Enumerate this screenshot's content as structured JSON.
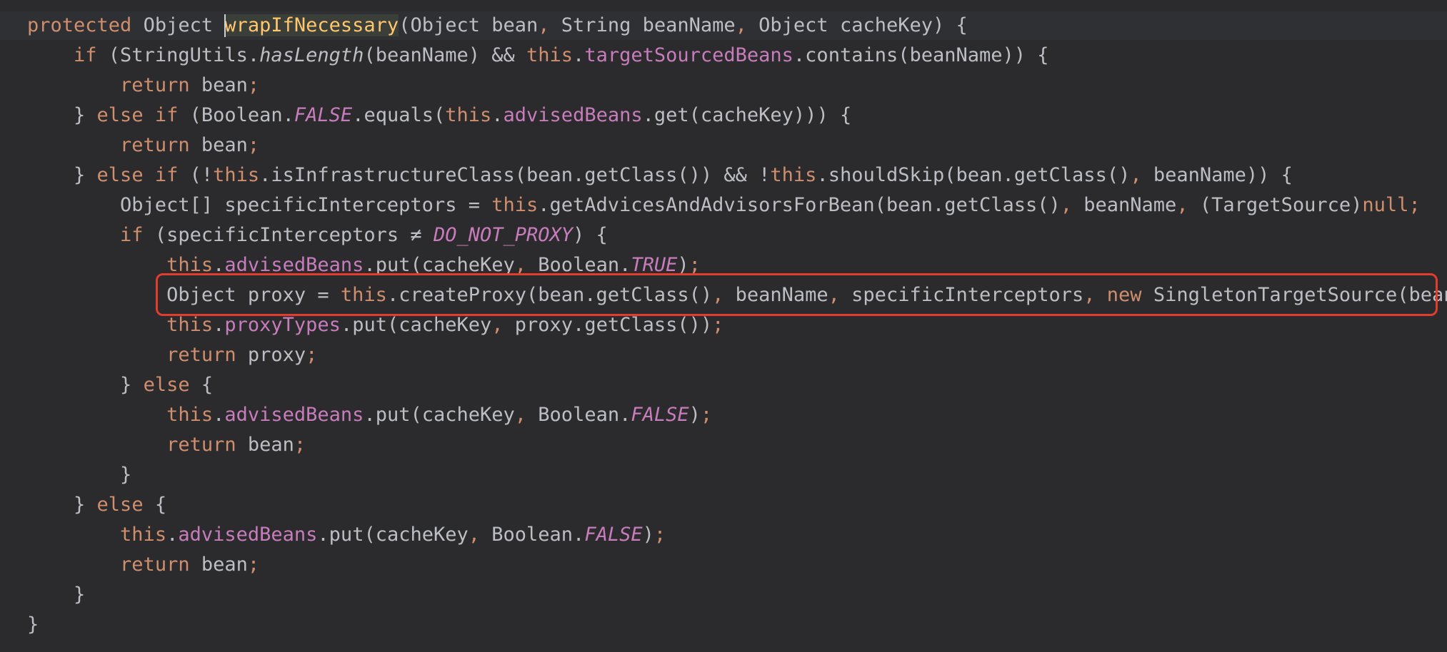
{
  "editor": {
    "language": "java",
    "theme_colors": {
      "background": "#2b2b2d",
      "keyword": "#cf8e6d",
      "field": "#c77dbb",
      "method_declaration": "#ffc66d",
      "text": "#bcbec4",
      "highlight_box": "#e23c2f"
    },
    "highlighted_line_index": 9,
    "lines": [
      [
        {
          "t": "protected",
          "c": "kw"
        },
        {
          "t": " Object "
        },
        {
          "t": "wrapIfNecessary",
          "c": "fn ident-hl"
        },
        {
          "t": "(Object bean"
        },
        {
          "t": ", ",
          "c": "kw"
        },
        {
          "t": "String beanName"
        },
        {
          "t": ", ",
          "c": "kw"
        },
        {
          "t": "Object cacheKey) {"
        }
      ],
      [
        {
          "t": "    "
        },
        {
          "t": "if",
          "c": "kw"
        },
        {
          "t": " (StringUtils."
        },
        {
          "t": "hasLength",
          "c": "ital"
        },
        {
          "t": "(beanName) && "
        },
        {
          "t": "this",
          "c": "kw"
        },
        {
          "t": "."
        },
        {
          "t": "targetSourcedBeans",
          "c": "fld"
        },
        {
          "t": ".contains(beanName)) {"
        }
      ],
      [
        {
          "t": "        "
        },
        {
          "t": "return",
          "c": "kw"
        },
        {
          "t": " bean"
        },
        {
          "t": ";",
          "c": "kw"
        }
      ],
      [
        {
          "t": "    } "
        },
        {
          "t": "else if",
          "c": "kw"
        },
        {
          "t": " (Boolean."
        },
        {
          "t": "FALSE",
          "c": "sfld"
        },
        {
          "t": ".equals("
        },
        {
          "t": "this",
          "c": "kw"
        },
        {
          "t": "."
        },
        {
          "t": "advisedBeans",
          "c": "fld"
        },
        {
          "t": ".get(cacheKey))) {"
        }
      ],
      [
        {
          "t": "        "
        },
        {
          "t": "return",
          "c": "kw"
        },
        {
          "t": " bean"
        },
        {
          "t": ";",
          "c": "kw"
        }
      ],
      [
        {
          "t": "    } "
        },
        {
          "t": "else if",
          "c": "kw"
        },
        {
          "t": " (!"
        },
        {
          "t": "this",
          "c": "kw"
        },
        {
          "t": ".isInfrastructureClass(bean.getClass()) && !"
        },
        {
          "t": "this",
          "c": "kw"
        },
        {
          "t": ".shouldSkip(bean.getClass()"
        },
        {
          "t": ", ",
          "c": "kw"
        },
        {
          "t": "beanName)) {"
        }
      ],
      [
        {
          "t": "        Object[] specificInterceptors = "
        },
        {
          "t": "this",
          "c": "kw"
        },
        {
          "t": ".getAdvicesAndAdvisorsForBean(bean.getClass()"
        },
        {
          "t": ", ",
          "c": "kw"
        },
        {
          "t": "beanName"
        },
        {
          "t": ", ",
          "c": "kw"
        },
        {
          "t": "(TargetSource)"
        },
        {
          "t": "null",
          "c": "kw"
        },
        {
          "t": ";",
          "c": "kw"
        }
      ],
      [
        {
          "t": "        "
        },
        {
          "t": "if",
          "c": "kw"
        },
        {
          "t": " (specificInterceptors ≠ "
        },
        {
          "t": "DO_NOT_PROXY",
          "c": "sfld"
        },
        {
          "t": ") {"
        }
      ],
      [
        {
          "t": "            "
        },
        {
          "t": "this",
          "c": "kw"
        },
        {
          "t": "."
        },
        {
          "t": "advisedBeans",
          "c": "fld"
        },
        {
          "t": ".put(cacheKey"
        },
        {
          "t": ", ",
          "c": "kw"
        },
        {
          "t": "Boolean."
        },
        {
          "t": "TRUE",
          "c": "sfld"
        },
        {
          "t": ")"
        },
        {
          "t": ";",
          "c": "kw"
        }
      ],
      [
        {
          "t": "            Object proxy = "
        },
        {
          "t": "this",
          "c": "kw"
        },
        {
          "t": ".createProxy(bean.getClass()"
        },
        {
          "t": ", ",
          "c": "kw"
        },
        {
          "t": "beanName"
        },
        {
          "t": ", ",
          "c": "kw"
        },
        {
          "t": "specificInterceptors"
        },
        {
          "t": ", ",
          "c": "kw"
        },
        {
          "t": "new",
          "c": "kw"
        },
        {
          "t": " SingletonTargetSource(bean))"
        },
        {
          "t": ";",
          "c": "kw"
        }
      ],
      [
        {
          "t": "            "
        },
        {
          "t": "this",
          "c": "kw"
        },
        {
          "t": "."
        },
        {
          "t": "proxyTypes",
          "c": "fld"
        },
        {
          "t": ".put(cacheKey"
        },
        {
          "t": ", ",
          "c": "kw"
        },
        {
          "t": "proxy.getClass())"
        },
        {
          "t": ";",
          "c": "kw"
        }
      ],
      [
        {
          "t": "            "
        },
        {
          "t": "return",
          "c": "kw"
        },
        {
          "t": " proxy"
        },
        {
          "t": ";",
          "c": "kw"
        }
      ],
      [
        {
          "t": "        } "
        },
        {
          "t": "else",
          "c": "kw"
        },
        {
          "t": " {"
        }
      ],
      [
        {
          "t": "            "
        },
        {
          "t": "this",
          "c": "kw"
        },
        {
          "t": "."
        },
        {
          "t": "advisedBeans",
          "c": "fld"
        },
        {
          "t": ".put(cacheKey"
        },
        {
          "t": ", ",
          "c": "kw"
        },
        {
          "t": "Boolean."
        },
        {
          "t": "FALSE",
          "c": "sfld"
        },
        {
          "t": ")"
        },
        {
          "t": ";",
          "c": "kw"
        }
      ],
      [
        {
          "t": "            "
        },
        {
          "t": "return",
          "c": "kw"
        },
        {
          "t": " bean"
        },
        {
          "t": ";",
          "c": "kw"
        }
      ],
      [
        {
          "t": "        }"
        }
      ],
      [
        {
          "t": "    } "
        },
        {
          "t": "else",
          "c": "kw"
        },
        {
          "t": " {"
        }
      ],
      [
        {
          "t": "        "
        },
        {
          "t": "this",
          "c": "kw"
        },
        {
          "t": "."
        },
        {
          "t": "advisedBeans",
          "c": "fld"
        },
        {
          "t": ".put(cacheKey"
        },
        {
          "t": ", ",
          "c": "kw"
        },
        {
          "t": "Boolean."
        },
        {
          "t": "FALSE",
          "c": "sfld"
        },
        {
          "t": ")"
        },
        {
          "t": ";",
          "c": "kw"
        }
      ],
      [
        {
          "t": "        "
        },
        {
          "t": "return",
          "c": "kw"
        },
        {
          "t": " bean"
        },
        {
          "t": ";",
          "c": "kw"
        }
      ],
      [
        {
          "t": "    }"
        }
      ],
      [
        {
          "t": "}"
        }
      ]
    ]
  }
}
